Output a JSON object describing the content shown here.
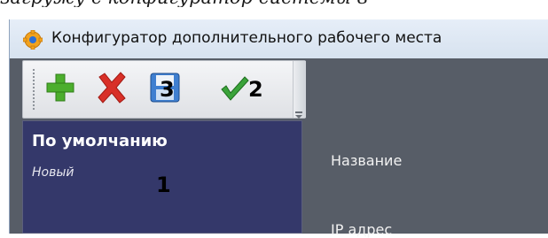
{
  "caption": "загружу с конфигуратор системы в",
  "window": {
    "title": "Конфигуратор дополнительного рабочего места"
  },
  "toolbar": {
    "add": {
      "icon": "plus-icon",
      "color": "#4cae2d"
    },
    "delete": {
      "icon": "red-x-icon",
      "color": "#d83028"
    },
    "save": {
      "icon": "save-icon",
      "callout": "3"
    },
    "apply": {
      "icon": "checkmark-icon",
      "color": "#3aa33a",
      "callout": "2"
    }
  },
  "list": {
    "items": [
      {
        "title": "По умолчанию",
        "subtitle": "Новый"
      }
    ],
    "callout": "1"
  },
  "form": {
    "name_label": "Название",
    "ip_label": "IP адрес"
  }
}
